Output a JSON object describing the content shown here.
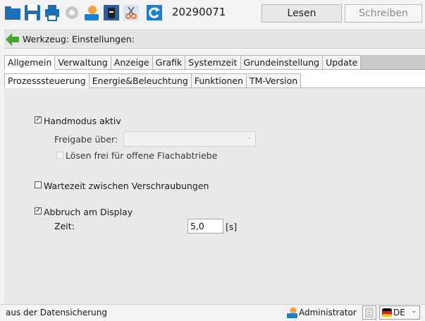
{
  "toolbar": {
    "icons": [
      "folder-icon",
      "save-icon",
      "printer-icon",
      "settings-gear-icon",
      "user-icon",
      "battery-icon",
      "cut-icon",
      "refresh-icon"
    ],
    "id_number": "20290071",
    "read_label": "Lesen",
    "write_label": "Schreiben"
  },
  "breadcrumb": {
    "label": "Werkzeug: Einstellungen:"
  },
  "tabs": {
    "main": [
      {
        "label": "Allgemein",
        "active": true
      },
      {
        "label": "Verwaltung",
        "active": false
      },
      {
        "label": "Anzeige",
        "active": false
      },
      {
        "label": "Grafik",
        "active": false
      },
      {
        "label": "Systemzeit",
        "active": false
      },
      {
        "label": "Grundeinstellung",
        "active": false
      },
      {
        "label": "Update",
        "active": false
      }
    ],
    "sub": [
      {
        "label": "Prozesssteuerung",
        "active": true
      },
      {
        "label": "Energie&Beleuchtung",
        "active": false
      },
      {
        "label": "Funktionen",
        "active": false
      },
      {
        "label": "TM-Version",
        "active": false
      }
    ]
  },
  "panel": {
    "handmode": {
      "label": "Handmodus aktiv",
      "checked": true
    },
    "release": {
      "label": "Freigabe über:",
      "value": ""
    },
    "loosen": {
      "label": "Lösen frei für offene Flachabtriebe",
      "checked": false,
      "disabled": true
    },
    "waittime": {
      "label": "Wartezeit zwischen Verschraubungen",
      "checked": false
    },
    "abort": {
      "label": "Abbruch am Display",
      "checked": true
    },
    "time": {
      "label": "Zeit:",
      "value": "5,0",
      "unit": "[s]"
    }
  },
  "status": {
    "message": "aus der Datensicherung",
    "user": "Administrator",
    "language": "DE"
  },
  "colors": {
    "accent_blue": "#1e7fd0",
    "folder_blue": "#1d6fb8",
    "green_arrow": "#4aa12e"
  }
}
